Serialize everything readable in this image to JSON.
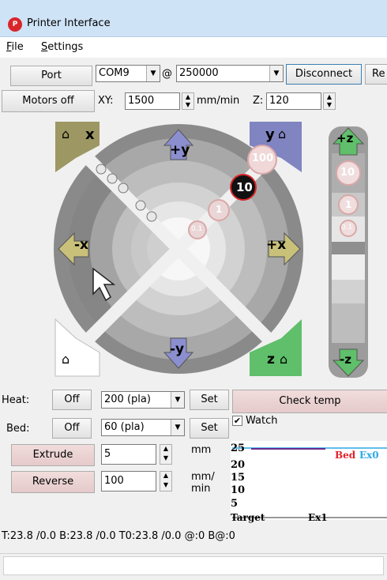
{
  "window": {
    "title": "Printer Interface",
    "app_icon_text": "P"
  },
  "menu": [
    {
      "label": "File",
      "accel": "F"
    },
    {
      "label": "Settings",
      "accel": "S"
    }
  ],
  "toolbar": {
    "port_label": "Port",
    "port_value": "COM9",
    "at_sign": "@",
    "baud_value": "250000",
    "disconnect_label": "Disconnect",
    "reset_label": "Re",
    "motors_off_label": "Motors off",
    "xy_label": "XY:",
    "xy_speed": "1500",
    "xy_unit": "mm/min",
    "z_label": "Z:",
    "z_speed": "120"
  },
  "jog": {
    "home_x": "x",
    "home_y": "y",
    "home_z": "z",
    "plus_y": "+y",
    "minus_y": "-y",
    "plus_x": "+x",
    "minus_x": "-x",
    "step_100": "100",
    "step_10": "10",
    "step_1": "1",
    "step_01": "0.1",
    "z_plus": "+z",
    "z_minus": "-z",
    "z_step_10": "10",
    "z_step_1": "1",
    "z_step_01": "0.1"
  },
  "heat": {
    "heat_label": "Heat:",
    "heat_off": "Off",
    "heat_value": "200 (pla)",
    "heat_set": "Set",
    "bed_label": "Bed:",
    "bed_off": "Off",
    "bed_value": "60 (pla)",
    "bed_set": "Set",
    "check_temp_label": "Check temp",
    "watch_label": "Watch",
    "watch_checked": "✔"
  },
  "extrude": {
    "extrude_label": "Extrude",
    "extrude_value": "5",
    "extrude_unit": "mm",
    "reverse_label": "Reverse",
    "reverse_value": "100",
    "feed_unit_top": "mm/",
    "feed_unit_bottom": "min"
  },
  "graph": {
    "y_ticks": [
      "25",
      "20",
      "15",
      "10",
      "5"
    ],
    "legend_bed": "Bed",
    "legend_ex0": "Ex0",
    "legend_target": "Target",
    "legend_ex1": "Ex1",
    "colors": {
      "bed": "#e0202a",
      "ex0": "#2aa9e6",
      "target": "#6a2a8a"
    }
  },
  "status_line": "T:23.8 /0.0 B:23.8 /0.0 T0:23.8 /0.0 @:0 B@:0"
}
